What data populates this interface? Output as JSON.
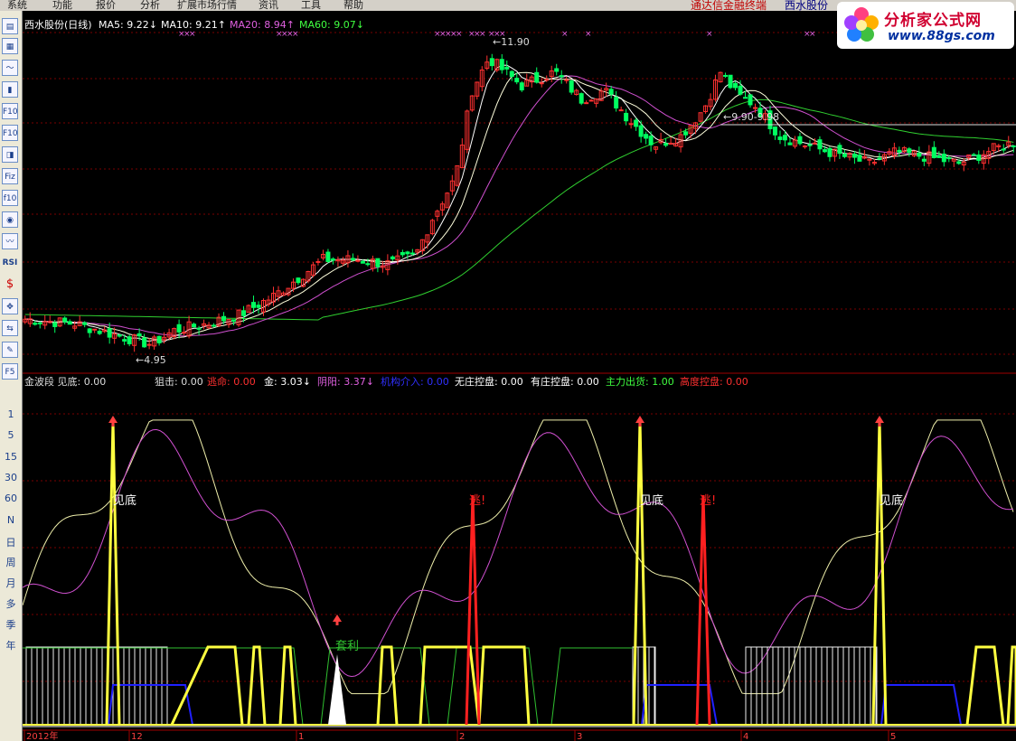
{
  "menu": [
    "系统",
    "功能",
    "报价",
    "分析",
    "扩展市场行情",
    "资讯",
    "工具",
    "帮助"
  ],
  "broker": {
    "text": "通达信金融终端",
    "stock": "西水股份"
  },
  "logo": {
    "title": "分析家公式网",
    "url": "www.88gs.com"
  },
  "sidebar": {
    "icons": [
      "list-icon",
      "table-icon",
      "line-chart-icon",
      "kline-icon",
      "F10-icon",
      "F10-alt-icon",
      "info-icon",
      "Fiz-icon",
      "f10-icon",
      "search-icon",
      "trend-icon",
      "RSI-icon",
      "dollar-icon",
      "move-icon",
      "switch-icon",
      "pencil-icon",
      "F5-icon"
    ],
    "labels": [
      "RSI",
      "F5"
    ],
    "periods": [
      "1",
      "5",
      "15",
      "30",
      "60",
      "N",
      "日",
      "周",
      "月",
      "多",
      "季",
      "年"
    ]
  },
  "main_header": [
    {
      "text": "西水股份(日线)",
      "color": "#ffffff"
    },
    {
      "text": "MA5: 9.22↓",
      "color": "#ffffff"
    },
    {
      "text": "MA10: 9.21↑",
      "color": "#ffffff"
    },
    {
      "text": "MA20: 8.94↑",
      "color": "#e060e0"
    },
    {
      "text": "MA60: 9.07↓",
      "color": "#40ff40"
    }
  ],
  "price_labels": {
    "high": "11.90",
    "low": "4.95",
    "range": "9.90-9.98"
  },
  "indicator_header": [
    {
      "text": "金波段  见底: 0.00",
      "color": "#dddddd"
    },
    {
      "text": "狙击: 0.00",
      "color": "#dddddd"
    },
    {
      "text": "逃命: 0.00",
      "color": "#ff3030"
    },
    {
      "text": "金: 3.03↓",
      "color": "#ffffff"
    },
    {
      "text": "阴阳: 3.37↓",
      "color": "#e060e0"
    },
    {
      "text": "机构介入: 0.00",
      "color": "#3030ff"
    },
    {
      "text": "无庄控盘: 0.00",
      "color": "#ffffff"
    },
    {
      "text": "有庄控盘: 0.00",
      "color": "#ffffff"
    },
    {
      "text": "主力出货: 1.00",
      "color": "#40ff40"
    },
    {
      "text": "高度控盘: 0.00",
      "color": "#ff3030"
    }
  ],
  "signals": {
    "bottom": "见底",
    "escape": "逃!",
    "profit": "套利"
  },
  "x_axis": [
    "2012年",
    "12",
    "1",
    "2",
    "3",
    "4",
    "5"
  ],
  "colors": {
    "up": "#ff3030",
    "down": "#00ff60",
    "ma5": "#ffffff",
    "ma10": "#ffffdd",
    "ma20": "#d050d0",
    "ma60": "#30d030",
    "grid": "#7a0000",
    "bottom": "#ffff40",
    "escape": "#ff2020",
    "band_green": "#30c030",
    "band_blue": "#2020ff"
  }
}
